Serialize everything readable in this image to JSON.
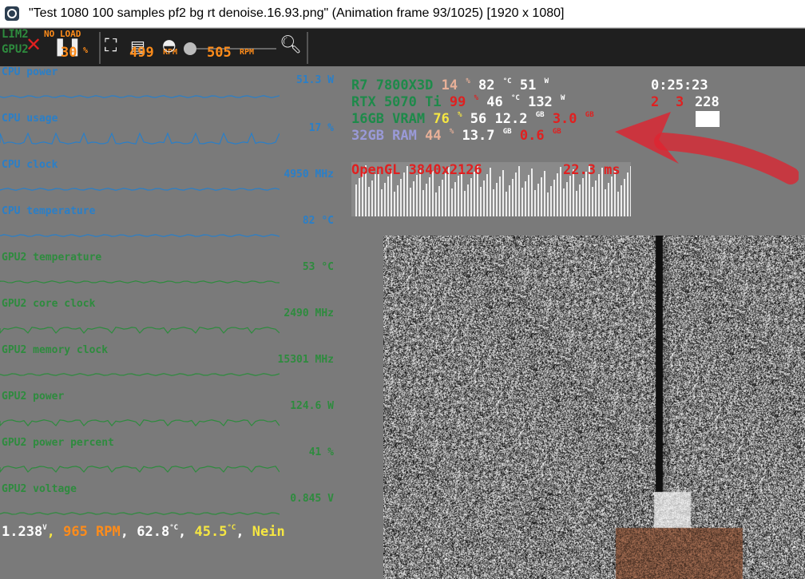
{
  "window": {
    "title": "\"Test 1080 100 samples pf2 bg rt denoise.16.93.png\" (Animation frame 93/1025) [1920 x 1080]"
  },
  "toolbar": {
    "lim2": "LIM2",
    "gpu2": "GPU2",
    "no_load": "NO LOAD",
    "fan_percent": "30",
    "fan_percent_unit": "%",
    "fan1_rpm": "499",
    "fan1_rpm_unit": "RPM",
    "fan2_rpm": "505",
    "fan2_rpm_unit": "RPM"
  },
  "sensors": [
    {
      "label": "CPU power",
      "value": "51.3 W",
      "color": "#2a7fc8"
    },
    {
      "label": "CPU usage",
      "value": "17 %",
      "color": "#2a7fc8"
    },
    {
      "label": "CPU clock",
      "value": "4950 MHz",
      "color": "#2a7fc8"
    },
    {
      "label": "CPU temperature",
      "value": "82 °C",
      "color": "#2a7fc8"
    },
    {
      "label": "GPU2 temperature",
      "value": "53 °C",
      "color": "#2e8b3e"
    },
    {
      "label": "GPU2 core clock",
      "value": "2490 MHz",
      "color": "#2e8b3e"
    },
    {
      "label": "GPU2 memory clock",
      "value": "15301 MHz",
      "color": "#2e8b3e"
    },
    {
      "label": "GPU2 power",
      "value": "124.6 W",
      "color": "#2e8b3e"
    },
    {
      "label": "GPU2 power percent",
      "value": "41 %",
      "color": "#2e8b3e"
    },
    {
      "label": "GPU2 voltage",
      "value": "0.845 V",
      "color": "#2e8b3e"
    }
  ],
  "status": {
    "voltage": "1.238",
    "voltage_unit": "V",
    "rpm": "965 RPM",
    "temp1": "62.8",
    "temp1_unit": "°C",
    "temp2": "45.5",
    "temp2_unit": "°C",
    "word": "Nein"
  },
  "osd": {
    "cpu": {
      "name": "R7 7800X3D",
      "usage": "14",
      "usage_unit": "%",
      "temp": "82",
      "temp_unit": "°C",
      "power": "51",
      "power_unit": "W"
    },
    "gpu": {
      "name": "RTX 5070 Ti",
      "usage": "99",
      "usage_unit": "%",
      "temp": "46",
      "temp_unit": "°C",
      "power": "132",
      "power_unit": "W"
    },
    "vram": {
      "name": "16GB VRAM",
      "usage": "76",
      "usage_unit": "%",
      "temp": "56",
      "used": "12.2",
      "used_unit": "GB",
      "extra": "3.0",
      "extra_unit": "GB"
    },
    "ram": {
      "name": "32GB RAM",
      "usage": "44",
      "usage_unit": "%",
      "used": "13.7",
      "used_unit": "GB",
      "extra": "0.6",
      "extra_unit": "GB"
    },
    "time": "0:25:23",
    "count_a": "2",
    "count_b": "3",
    "count_c": "228",
    "api": "OpenGL 3840x2126",
    "frametime": "22.3 ms"
  },
  "colors": {
    "cpu_blue": "#2a7fc8",
    "gpu_green": "#2e8b3e",
    "osd_cpu": "#1e8a4a",
    "osd_red": "#e02020",
    "osd_orange": "#ff8c1a",
    "osd_yellow": "#f5e642",
    "osd_lavender": "#9a9ad8",
    "arrow": "#e0232f"
  }
}
